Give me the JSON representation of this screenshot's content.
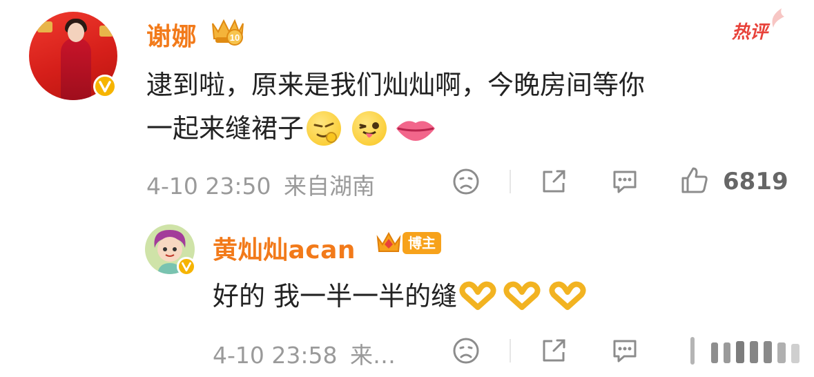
{
  "comment": {
    "username": "谢娜",
    "level_badge": "10",
    "hot_label": "热评",
    "text_line1": "逮到啦，原来是我们灿灿啊，今晚房间等你",
    "text_line2": "一起来缝裙子",
    "timestamp": "4-10 23:50",
    "location": "来自湖南",
    "like_count": "6819",
    "emojis": [
      "sneaky-face-icon",
      "tongue-wink-icon",
      "lips-icon"
    ]
  },
  "reply": {
    "username": "黄灿灿acan",
    "role_badge": "博主",
    "text": "好的 我一半一半的缝",
    "timestamp": "4-10 23:58",
    "location_truncated": "来…",
    "emojis": [
      "heart-hands-icon",
      "heart-hands-icon",
      "heart-hands-icon"
    ]
  },
  "colors": {
    "username": "#f27a1a",
    "hot": "#e8423a",
    "verified": "#f6b400",
    "meta": "#9a9a9a"
  }
}
